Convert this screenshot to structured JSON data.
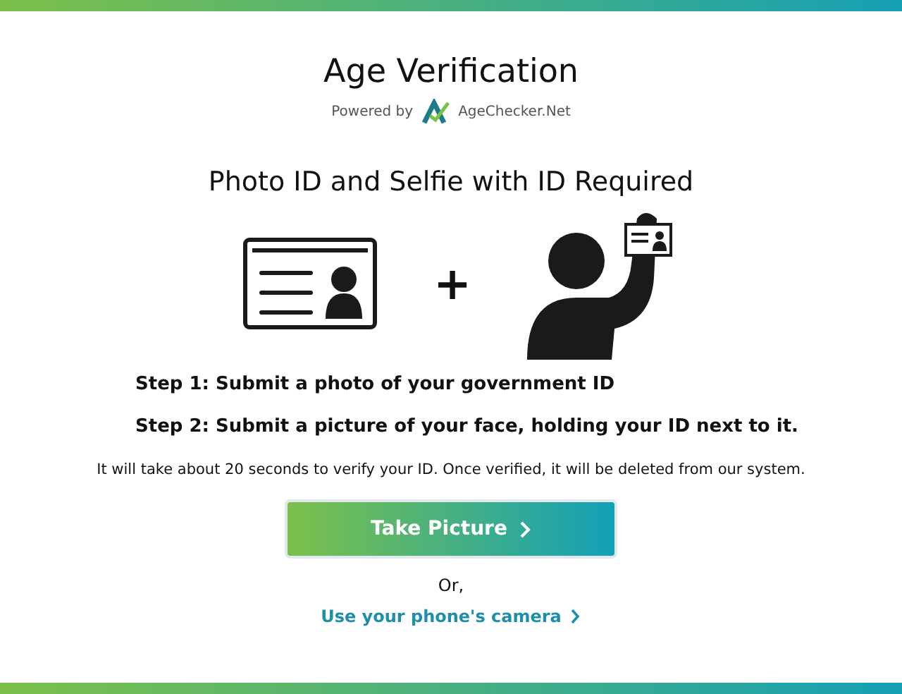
{
  "header": {
    "title": "Age Verification",
    "powered_by": "Powered by",
    "brand": "AgeChecker.Net"
  },
  "heading": "Photo ID and Selfie with ID Required",
  "plus": "+",
  "steps": [
    "Step 1: Submit a photo of your government ID",
    "Step 2: Submit a picture of your face, holding your ID next to it."
  ],
  "note": "It will take about 20 seconds to verify your ID. Once verified, it will be deleted from our system.",
  "primary_button": "Take Picture",
  "or_text": "Or,",
  "phone_link": "Use your phone's camera"
}
